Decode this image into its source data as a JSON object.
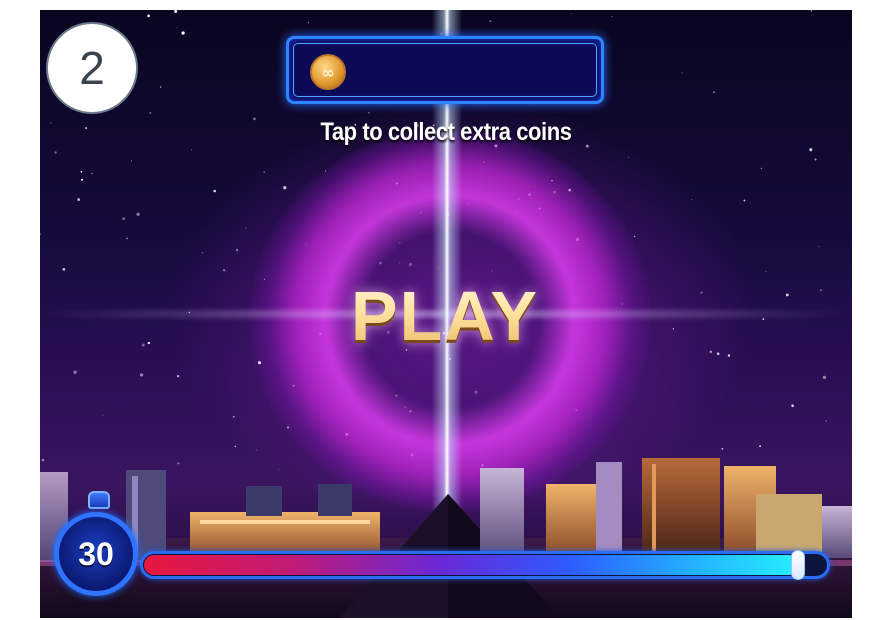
{
  "step_badge": {
    "number": "2"
  },
  "coin_bar": {
    "coin_icon": "infinity-coin-icon",
    "value": ""
  },
  "prompt": {
    "collect_text": "Tap to collect extra coins"
  },
  "play": {
    "label": "PLAY"
  },
  "timer": {
    "icon": "stopwatch-icon",
    "value": "30"
  },
  "progress": {
    "fraction": 0.96
  },
  "colors": {
    "accent_blue": "#2b86ff",
    "play_gold": "#ffe3a0",
    "portal_magenta": "#dc3cf0",
    "progress_start": "#e8173e",
    "progress_end": "#27f0ff"
  }
}
